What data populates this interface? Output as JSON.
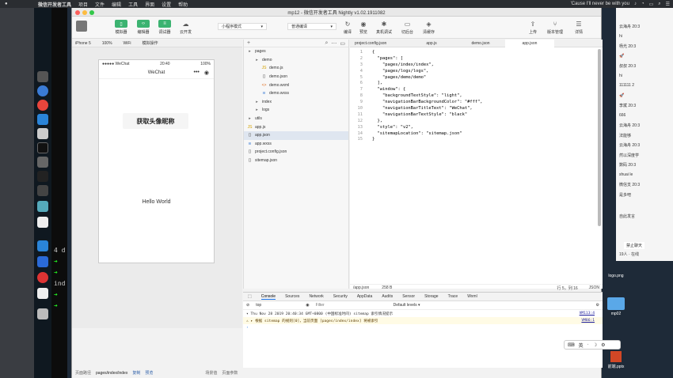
{
  "menubar": {
    "apple": "",
    "items": [
      "微信开发者工具",
      "项目",
      "文件",
      "编辑",
      "工具",
      "界面",
      "设置",
      "帮助"
    ],
    "now_playing": "'Cause I'll never be with you"
  },
  "window": {
    "title": "mp12 - 微信开发者工具 Nightly v1.02.1911082"
  },
  "toolbar": {
    "simulator": "模拟器",
    "editor": "编辑器",
    "debugger": "调试器",
    "cloud": "云开发",
    "mode": "小程序模式",
    "compile_mode": "普通编译",
    "compile": "编译",
    "preview": "预览",
    "real_debug": "真机调试",
    "background": "切后台",
    "clear_cache": "清缓存",
    "upload": "上传",
    "version": "版本管理",
    "details": "详情"
  },
  "simbar": {
    "device": "iPhone 5",
    "zoom": "100%",
    "network": "WiFi",
    "action": "模拟操作"
  },
  "phone": {
    "carrier": "●●●●● WeChat",
    "time": "20:40",
    "battery": "100%",
    "nav_title": "WeChat",
    "button": "获取头像昵称",
    "hello": "Hello World"
  },
  "sim_footer": {
    "path_label": "页面路径",
    "path": "pages/index/index",
    "copy": "复制",
    "preview": "预览",
    "scene": "场景值",
    "params": "页面参数"
  },
  "tree": {
    "items": [
      {
        "label": "pages",
        "type": "folder",
        "indent": 0
      },
      {
        "label": "demo",
        "type": "folder",
        "indent": 1
      },
      {
        "label": "demo.js",
        "type": "js",
        "indent": 2
      },
      {
        "label": "demo.json",
        "type": "json",
        "indent": 2
      },
      {
        "label": "demo.wxml",
        "type": "wxml",
        "indent": 2
      },
      {
        "label": "demo.wxss",
        "type": "wxss",
        "indent": 2
      },
      {
        "label": "index",
        "type": "folder",
        "indent": 1
      },
      {
        "label": "logs",
        "type": "folder",
        "indent": 1
      },
      {
        "label": "utils",
        "type": "folder",
        "indent": 0
      },
      {
        "label": "app.js",
        "type": "js",
        "indent": 0
      },
      {
        "label": "app.json",
        "type": "json",
        "indent": 0,
        "selected": true
      },
      {
        "label": "app.wxss",
        "type": "wxss",
        "indent": 0
      },
      {
        "label": "project.config.json",
        "type": "json",
        "indent": 0
      },
      {
        "label": "sitemap.json",
        "type": "json",
        "indent": 0
      }
    ]
  },
  "editor": {
    "tabs": [
      "project.config.json",
      "app.js",
      "demo.json",
      "app.json"
    ],
    "active_tab": 3,
    "lines": [
      "{",
      "  \"pages\": [",
      "    \"pages/index/index\",",
      "    \"pages/logs/logs\",",
      "    \"pages/demo/demo\"",
      "  ],",
      "  \"window\": {",
      "    \"backgroundTextStyle\": \"light\",",
      "    \"navigationBarBackgroundColor\": \"#fff\",",
      "    \"navigationBarTitleText\": \"WeChat\",",
      "    \"navigationBarTextStyle\": \"black\"",
      "  },",
      "  \"style\": \"v2\",",
      "  \"sitemapLocation\": \"sitemap.json\"",
      "}"
    ],
    "status_file": "/app.json",
    "status_size": "258 B",
    "status_pos": "行 5，列 16",
    "status_lang": "JSON"
  },
  "devtools": {
    "tabs": [
      "Console",
      "Sources",
      "Network",
      "Security",
      "AppData",
      "Audits",
      "Sensor",
      "Storage",
      "Trace",
      "Wxml"
    ],
    "context": "top",
    "filter_placeholder": "Filter",
    "levels": "Default levels ▾",
    "log1": "▾ Thu Nov 28 2019 20:40:34 GMT+0800 (中国标准时间) sitemap 索引情况提示",
    "log1_src": "VM113:4",
    "log2": "⚠ ▸ 根据 sitemap 的规则[0]，当前页面 [pages/index/index] 将被索引",
    "log2_src": "VM86:1",
    "prompt": "›"
  },
  "chat": {
    "rows": [
      "云海舟 20:3",
      "hi",
      "杨光 20:3",
      "🚀",
      "叔叔 20:3",
      "hi",
      "111111 2",
      "🚀",
      "李斌 20:3",
      "666",
      "云海舟 20:3",
      "法能够",
      "云海舟 20:3",
      "然以深度学",
      "数码 20:3",
      "shuai le",
      "微信支 20:3",
      "是多吧"
    ],
    "system": "自此发言",
    "footer1": "禁止聊天",
    "footer2": "19人 · 在线"
  },
  "desktop": {
    "file1": "logo.png",
    "folder": "mp02",
    "file2": "前端.pptx"
  },
  "float_toolbar": [
    "英",
    "·",
    "☽",
    "⚙"
  ]
}
